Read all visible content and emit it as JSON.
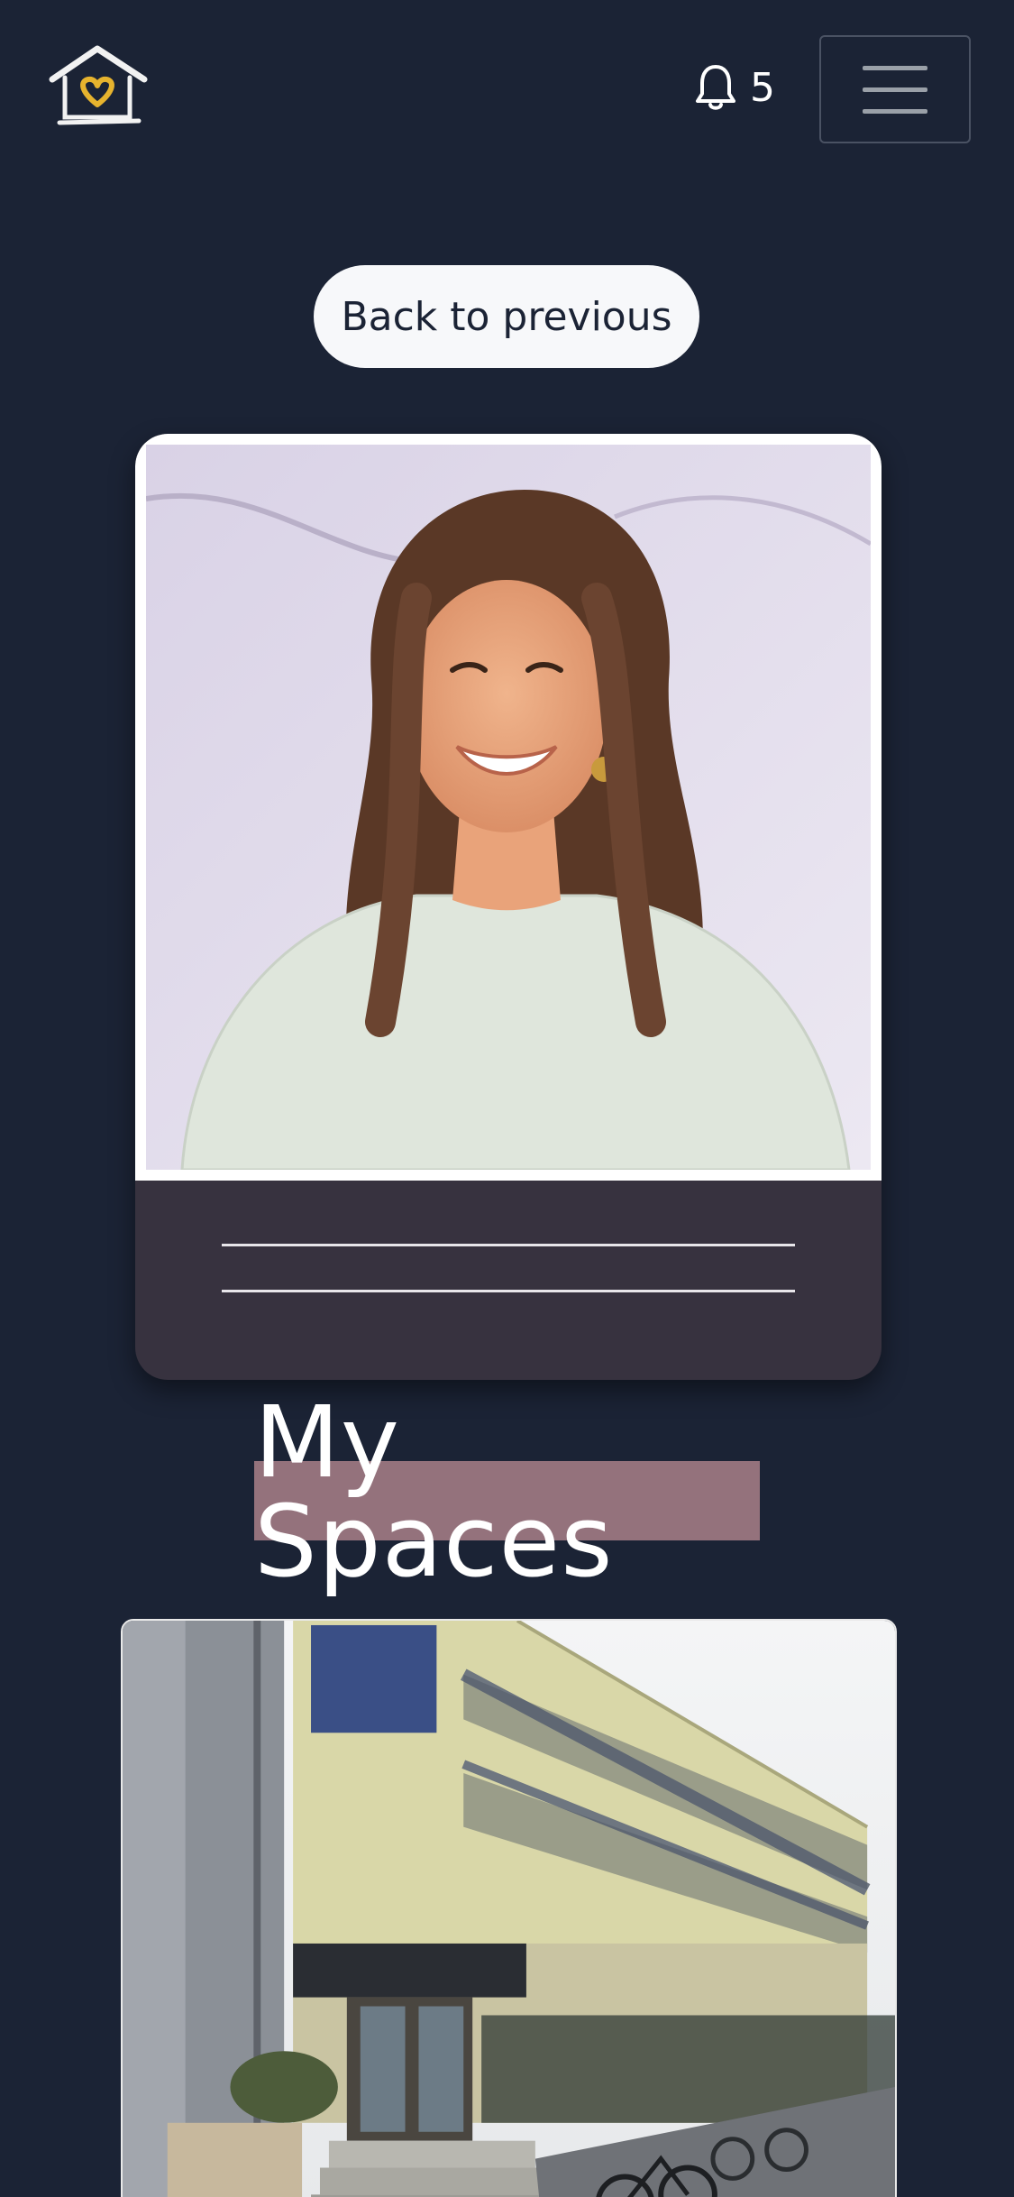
{
  "header": {
    "logo_alt": "home heart logo",
    "notifications_count": "5",
    "menu_label": "Open menu"
  },
  "back_button": {
    "label": "Back to previous"
  },
  "profile": {
    "photo_alt": "Smiling woman with long brown hair against a light wall",
    "name_lines": 2
  },
  "sections": {
    "spaces_title": "My Spaces"
  },
  "spaces": [
    {
      "photo_alt": "Three-storey apartment building with bicycles parked outside"
    }
  ],
  "colors": {
    "background": "#1b2335",
    "card_footer": "#37323f",
    "title_highlight": "#94727c",
    "logo_heart": "#e6b32e"
  }
}
